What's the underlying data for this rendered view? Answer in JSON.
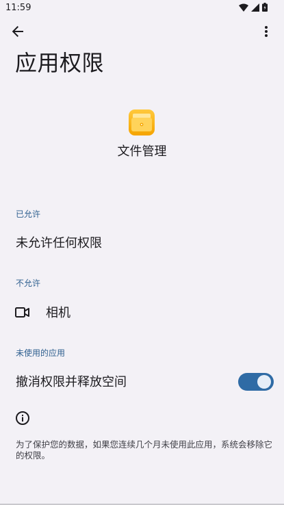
{
  "status_bar": {
    "time": "11:59",
    "icons": [
      "wifi-icon",
      "signal-icon",
      "battery-icon"
    ]
  },
  "app_bar": {
    "back_icon": "arrow-back-icon",
    "more_icon": "more-vert-icon"
  },
  "page": {
    "title": "应用权限"
  },
  "app": {
    "name": "文件管理",
    "icon": "file-manager-app-icon",
    "icon_color": "#f7b500"
  },
  "sections": {
    "allowed": {
      "label": "已允许",
      "empty_text": "未允许任何权限"
    },
    "denied": {
      "label": "不允许",
      "items": [
        {
          "icon": "camera-icon",
          "label": "相机"
        }
      ]
    },
    "unused": {
      "label": "未使用的应用",
      "toggle_label": "撤消权限并释放空间",
      "toggle_on": true,
      "toggle_color": "#2f6ba5"
    }
  },
  "footer": {
    "icon": "info-icon",
    "text": "为了保护您的数据，如果您连续几个月未使用此应用，系统会移除它的权限。"
  },
  "colors": {
    "background": "#f3f1f6",
    "section_label": "#2e5f8f"
  }
}
